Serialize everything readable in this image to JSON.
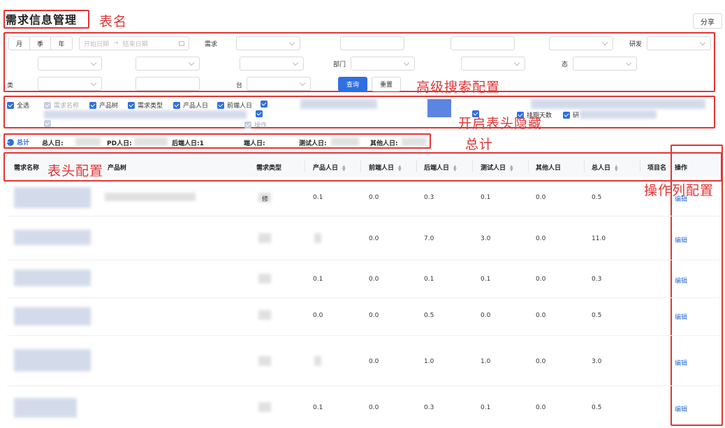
{
  "header": {
    "title": "需求信息管理",
    "share_label": "分享"
  },
  "annotations": {
    "table_name": "表名",
    "advanced_search": "高级搜索配置",
    "header_hide": "开启表头隐藏",
    "total": "总计",
    "header_config": "表头配置",
    "action_column": "操作列配置"
  },
  "filters": {
    "period_tabs": [
      "月",
      "季",
      "年"
    ],
    "start_date_placeholder": "开始日期",
    "end_date_placeholder": "结束日期",
    "date_separator": "→",
    "labels": {
      "demand": "需求",
      "rd": "研发",
      "dept": "部门",
      "platform": "台",
      "type_short": "类",
      "status_short": "态"
    },
    "query_button": "查询",
    "reset_button": "重置"
  },
  "columns_toggle": {
    "select_all": "全选",
    "items": [
      "需求名称",
      "产品树",
      "需求类型",
      "产品人日",
      "前端人日",
      "排期天数",
      "研",
      "排期",
      "操作"
    ]
  },
  "summary": {
    "label": "总计",
    "items": [
      "总人日:",
      "PD人日:",
      "后端人日:1",
      "端人日:",
      "测试人日:",
      "其他人日:"
    ]
  },
  "table": {
    "columns": [
      "需求名称",
      "产品树",
      "需求类型",
      "产品人日",
      "前端人日",
      "后端人日",
      "测试人日",
      "其他人日",
      "总人日",
      "项目名",
      "操作"
    ],
    "rows": [
      {
        "type": "修",
        "pd": "0.1",
        "fe": "0.0",
        "be": "0.3",
        "qa": "0.1",
        "other": "0.0",
        "total": "0.5",
        "action": "编辑"
      },
      {
        "type": "",
        "pd": "",
        "fe": "0.0",
        "be": "7.0",
        "qa": "3.0",
        "other": "0.0",
        "total": "11.0",
        "action": "编辑"
      },
      {
        "type": "",
        "pd": "0.1",
        "fe": "0.0",
        "be": "0.1",
        "qa": "0.1",
        "other": "0.0",
        "total": "0.3",
        "action": "编辑"
      },
      {
        "type": "",
        "pd": "0.0",
        "fe": "0.0",
        "be": "0.5",
        "qa": "0.0",
        "other": "0.0",
        "total": "0.5",
        "action": "编辑"
      },
      {
        "type": "",
        "pd": "",
        "fe": "0.0",
        "be": "1.0",
        "qa": "1.0",
        "other": "0.0",
        "total": "3.0",
        "action": "编辑"
      },
      {
        "type": "",
        "pd": "0.1",
        "fe": "0.0",
        "be": "0.3",
        "qa": "0.1",
        "other": "0.0",
        "total": "0.5",
        "action": "编辑"
      }
    ]
  },
  "colors": {
    "accent": "#2f6fe0",
    "annotation": "#e03535"
  }
}
